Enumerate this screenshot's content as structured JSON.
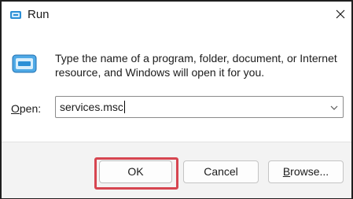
{
  "window": {
    "title": "Run"
  },
  "description": {
    "text": "Type the name of a program, folder, document, or Internet resource, and Windows will open it for you."
  },
  "open_field": {
    "label_accel": "O",
    "label_rest": "pen:",
    "value": "services.msc"
  },
  "buttons": {
    "ok": "OK",
    "cancel": "Cancel",
    "browse_accel": "B",
    "browse_rest": "rowse..."
  },
  "icons": {
    "app": "run-dialog-icon",
    "close": "close-icon",
    "dropdown": "chevron-down-icon"
  },
  "colors": {
    "highlight": "#d64550",
    "accent": "#2b8fd6"
  }
}
